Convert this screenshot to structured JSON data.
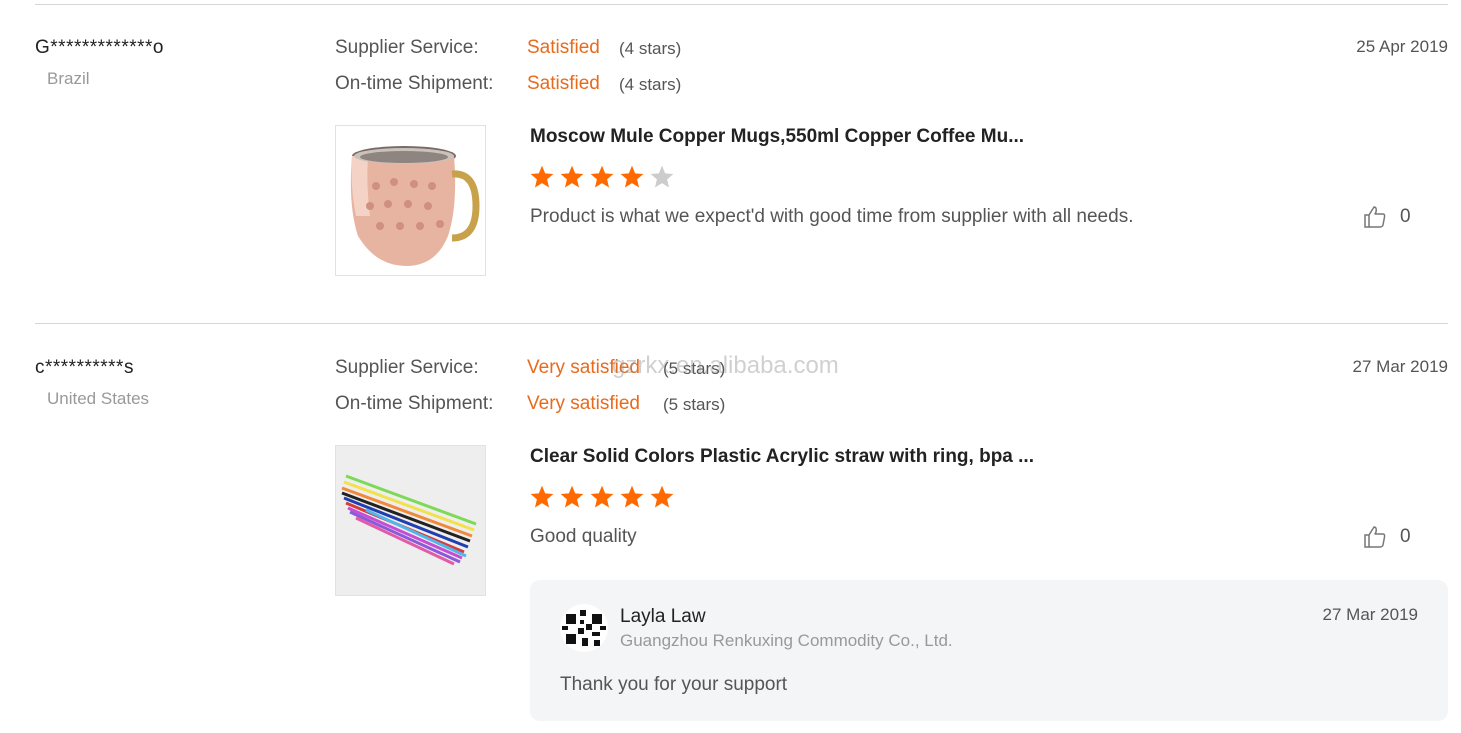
{
  "reviews": [
    {
      "buyer": "G*************o",
      "country": "Brazil",
      "date": "25 Apr 2019",
      "supplier_service_label": "Supplier Service:",
      "supplier_service_value": "Satisfied",
      "supplier_service_stars": "(4 stars)",
      "shipment_label": "On-time Shipment:",
      "shipment_value": "Satisfied",
      "shipment_stars": "(4 stars)",
      "product_title": "Moscow Mule Copper Mugs,550ml Copper Coffee Mu...",
      "product_rating": 4,
      "comment": "Product is what we expect'd with good time from supplier with all needs.",
      "likes": "0",
      "thumbnail_icon": "copper-mug-image"
    },
    {
      "buyer": "c**********s",
      "country": "United States",
      "date": "27 Mar 2019",
      "supplier_service_label": "Supplier Service:",
      "supplier_service_value": "Very satisfied",
      "supplier_service_stars": "(5 stars)",
      "shipment_label": "On-time Shipment:",
      "shipment_value": "Very satisfied",
      "shipment_stars": "(5 stars)",
      "product_title": "Clear Solid Colors Plastic Acrylic straw with ring, bpa ...",
      "product_rating": 5,
      "comment": "Good quality",
      "likes": "0",
      "thumbnail_icon": "colored-straws-image",
      "reply": {
        "name": "Layla Law",
        "company": "Guangzhou Renkuxing Commodity Co., Ltd.",
        "date": "27 Mar 2019",
        "text": "Thank you for your support"
      }
    }
  ],
  "watermark": "gzrkx.en.alibaba.com",
  "colors": {
    "accent": "#e86a1c",
    "star_filled": "#ff6a00",
    "star_empty": "#cccccc",
    "reply_bg": "#f4f5f6"
  }
}
